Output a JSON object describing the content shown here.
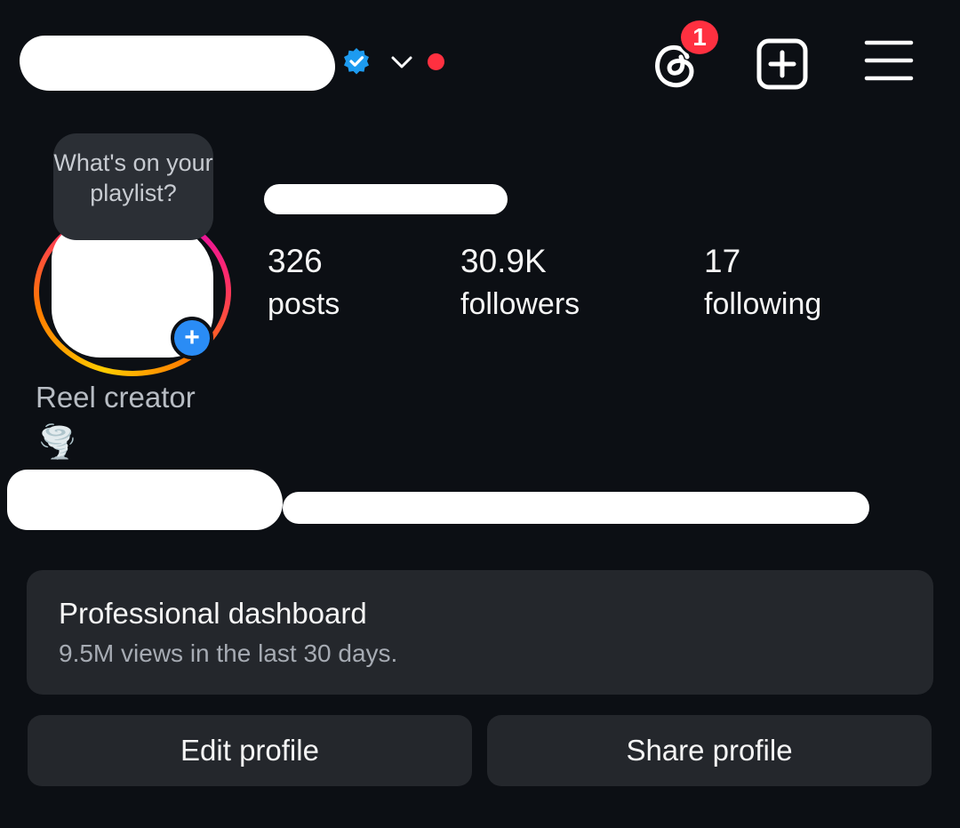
{
  "header": {
    "notification_count": "1",
    "icons": [
      "verified-badge-icon",
      "chevron-down-icon",
      "threads-icon",
      "add-post-icon",
      "menu-icon"
    ],
    "colors": {
      "verified": "#1d9bf0",
      "live_dot": "#ff3040",
      "badge": "#ff3040"
    }
  },
  "profile": {
    "note_text": "What's on your playlist?",
    "category": "Reel creator",
    "emoji": "🌪️"
  },
  "stats": [
    {
      "value": "326",
      "label": "posts"
    },
    {
      "value": "30.9K",
      "label": "followers"
    },
    {
      "value": "17",
      "label": "following"
    }
  ],
  "dashboard": {
    "title": "Professional dashboard",
    "subtitle": "9.5M views in the last 30 days."
  },
  "buttons": {
    "edit": "Edit profile",
    "share": "Share profile"
  }
}
